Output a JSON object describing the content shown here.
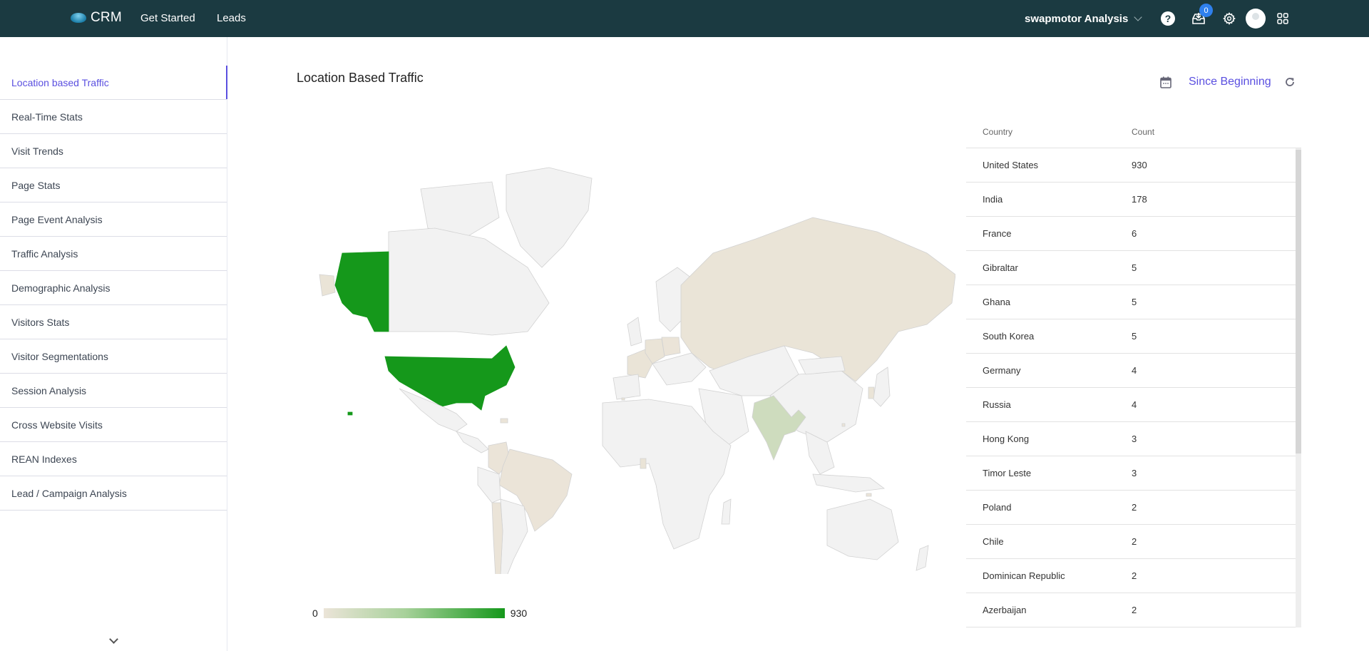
{
  "header": {
    "brand": "CRM",
    "nav": [
      "Get Started",
      "Leads"
    ],
    "org_name": "swapmotor Analysis",
    "notification_count": "0",
    "colors": {
      "bar": "#1b3a41",
      "badge": "#2f80ed"
    }
  },
  "sidebar": {
    "items": [
      {
        "label": "Location based Traffic",
        "active": true
      },
      {
        "label": "Real-Time Stats"
      },
      {
        "label": "Visit Trends"
      },
      {
        "label": "Page Stats"
      },
      {
        "label": "Page Event Analysis"
      },
      {
        "label": "Traffic Analysis"
      },
      {
        "label": "Demographic Analysis"
      },
      {
        "label": "Visitors Stats"
      },
      {
        "label": "Visitor Segmentations"
      },
      {
        "label": "Session Analysis"
      },
      {
        "label": "Cross Website Visits"
      },
      {
        "label": "REAN Indexes"
      },
      {
        "label": "Lead / Campaign Analysis"
      }
    ],
    "accent": "#5a4fe0"
  },
  "main": {
    "title": "Location Based Traffic",
    "date_range": "Since Beginning",
    "legend": {
      "min": "0",
      "max": "930",
      "min_color": "#ebe4d8",
      "max_color": "#15981b"
    },
    "table": {
      "headers": [
        "Country",
        "Count"
      ],
      "rows": [
        [
          "United States",
          "930"
        ],
        [
          "India",
          "178"
        ],
        [
          "France",
          "6"
        ],
        [
          "Gibraltar",
          "5"
        ],
        [
          "Ghana",
          "5"
        ],
        [
          "South Korea",
          "5"
        ],
        [
          "Germany",
          "4"
        ],
        [
          "Russia",
          "4"
        ],
        [
          "Hong Kong",
          "3"
        ],
        [
          "Timor Leste",
          "3"
        ],
        [
          "Poland",
          "2"
        ],
        [
          "Chile",
          "2"
        ],
        [
          "Dominican Republic",
          "2"
        ],
        [
          "Azerbaijan",
          "2"
        ]
      ]
    }
  },
  "chart_data": {
    "type": "heatmap",
    "title": "Location Based Traffic",
    "scale": {
      "min": 0,
      "max": 930
    },
    "highlighted_regions": [
      {
        "name": "United States",
        "value": 930
      },
      {
        "name": "India",
        "value": 178
      },
      {
        "name": "France",
        "value": 6
      },
      {
        "name": "Gibraltar",
        "value": 5
      },
      {
        "name": "Ghana",
        "value": 5
      },
      {
        "name": "South Korea",
        "value": 5
      },
      {
        "name": "Germany",
        "value": 4
      },
      {
        "name": "Russia",
        "value": 4
      },
      {
        "name": "Hong Kong",
        "value": 3
      },
      {
        "name": "Timor Leste",
        "value": 3
      },
      {
        "name": "Poland",
        "value": 2
      },
      {
        "name": "Chile",
        "value": 2
      },
      {
        "name": "Dominican Republic",
        "value": 2
      },
      {
        "name": "Azerbaijan",
        "value": 2
      },
      {
        "name": "Brazil",
        "value": 1
      },
      {
        "name": "Colombia",
        "value": 1
      }
    ]
  }
}
